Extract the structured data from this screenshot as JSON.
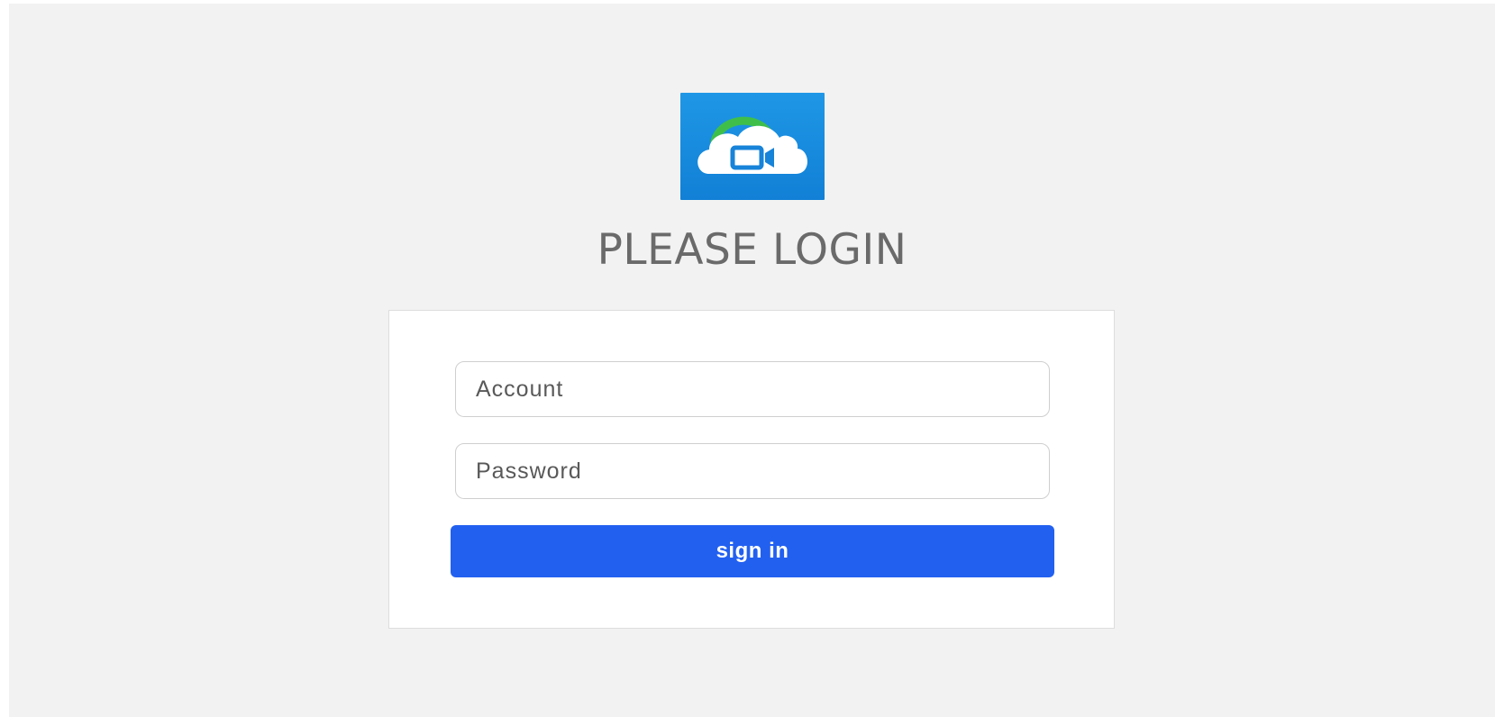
{
  "login": {
    "title": "PLEASE LOGIN",
    "account_placeholder": "Account",
    "password_placeholder": "Password",
    "signin_label": "sign in",
    "logo_icon": "cloud-video-camera-icon"
  },
  "colors": {
    "background": "#f2f2f2",
    "card": "#ffffff",
    "primary_button": "#2260f0",
    "logo_blue": "#1a8fe0",
    "logo_green": "#3fbf4a",
    "title_text": "#6a6a6a"
  }
}
